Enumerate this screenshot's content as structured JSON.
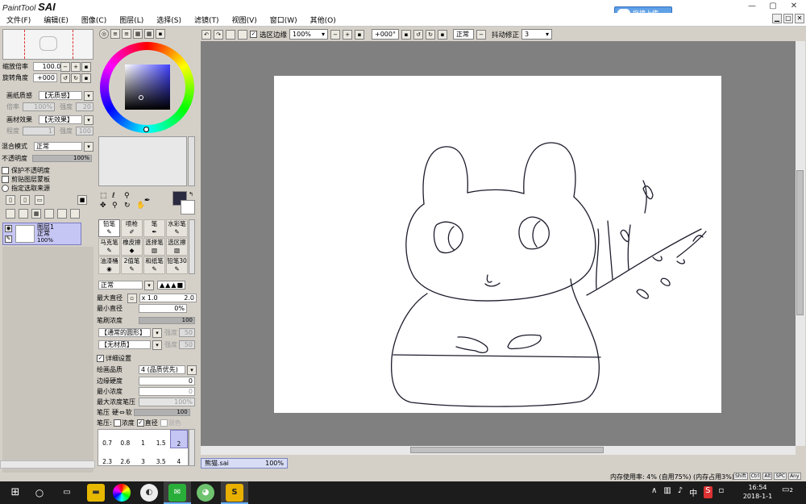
{
  "app": {
    "logo_small": "PaintTool",
    "logo_big": "SAI",
    "upload_label": "拖拽上传",
    "window_buttons": [
      "—",
      "▢",
      "✕"
    ]
  },
  "menu": [
    "文件(F)",
    "编辑(E)",
    "图像(C)",
    "图层(L)",
    "选择(S)",
    "滤镜(T)",
    "视图(V)",
    "窗口(W)",
    "其他(O)"
  ],
  "toolbar": {
    "selection_edge_label": "选区边缘",
    "zoom_value": "100%",
    "rotation_value": "+000°",
    "blend_mode": "正常",
    "stabilizer_label": "抖动修正",
    "stabilizer_value": "3"
  },
  "navigator": {
    "zoom_label": "缩放倍率",
    "zoom_value": "100.0%",
    "rotate_label": "旋转角度",
    "rotate_value": "+000"
  },
  "layer_panel": {
    "paper_texture_label": "画纸质感",
    "paper_texture_value": "【无质感】",
    "paper_rate_label": "倍率",
    "paper_rate_value": "100%",
    "paper_strength_label": "强度",
    "paper_strength_value": "20",
    "material_effect_label": "画材效果",
    "material_effect_value": "【无效果】",
    "material_degree_label": "程度",
    "material_degree_value": "1",
    "material_strength_label": "强度",
    "material_strength_value": "100",
    "blend_label": "混合模式",
    "blend_value": "正常",
    "opacity_label": "不透明度",
    "opacity_value": "100%",
    "protect_opacity": "保护不透明度",
    "clip_group": "剪贴图层蒙板",
    "select_source": "指定选取来源",
    "layer_name": "图层1",
    "layer_mode": "正常",
    "layer_opacity": "100%"
  },
  "brush_tools": [
    {
      "label": "铅笔"
    },
    {
      "label": "喷枪"
    },
    {
      "label": "笔"
    },
    {
      "label": "水彩笔"
    },
    {
      "label": "马克笔"
    },
    {
      "label": "橡皮擦"
    },
    {
      "label": "选择笔"
    },
    {
      "label": "选区擦"
    },
    {
      "label": "油漆桶"
    },
    {
      "label": "2值笔"
    },
    {
      "label": "和纸笔"
    },
    {
      "label": "铅笔30"
    }
  ],
  "brush_settings": {
    "mode": "正常",
    "max_size_label": "最大直径",
    "max_size_mult": "x 1.0",
    "max_size_value": "2.0",
    "min_size_label": "最小直径",
    "min_size_value": "0%",
    "density_label": "笔刷浓度",
    "density_value": "100",
    "shape_value": "【通常的圆形】",
    "shape_strength_label": "强度",
    "shape_strength_value": "50",
    "texture_value": "【无材质】",
    "texture_strength_label": "强度",
    "texture_strength_value": "50",
    "details_label": "详细设置",
    "quality_label": "绘画品质",
    "quality_value": "4 (品质优先)",
    "edge_hardness_label": "边缘硬度",
    "edge_hardness_value": "0",
    "min_density_label": "最小浓度",
    "min_density_value": "0",
    "max_density_pressure_label": "最大浓度笔压",
    "max_density_pressure_value": "100%",
    "pressure_label": "笔压",
    "pressure_hard": "硬",
    "pressure_soft": "软",
    "pressure_value": "100",
    "pressure_opts_label": "笔压:",
    "pressure_density": "浓度",
    "pressure_size": "直径",
    "pressure_blend": "混色",
    "sizes": [
      "0.7",
      "0.8",
      "1",
      "1.5",
      "2",
      "2.3",
      "2.6",
      "3",
      "3.5",
      "4"
    ]
  },
  "status": {
    "file_name": "熊猫.sai",
    "file_zoom": "100%",
    "memory_text": "内存使用率: 4% (自用75%)  (内存占用3%)",
    "keys": [
      "Shift",
      "Ctrl",
      "Alt",
      "SPC",
      "Any"
    ]
  },
  "taskbar": {
    "time": "16:54",
    "date": "2018-1-1",
    "ime": "中",
    "notifications": "2"
  },
  "colors": {
    "accent": "#5fa0e6",
    "canvas_bg": "#808080",
    "panel_bg": "#d4d0c8",
    "layer_highlight": "#c6c6f5",
    "primary_color": "#2a2a40"
  }
}
